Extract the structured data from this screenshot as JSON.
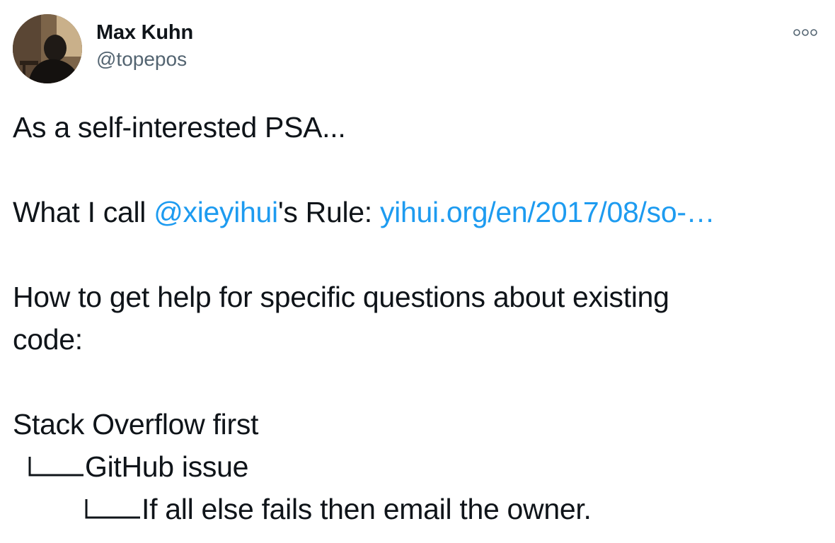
{
  "author": {
    "display_name": "Max Kuhn",
    "handle": "@topepos"
  },
  "icons": {
    "more": "more-horizontal-icon",
    "avatar": "avatar-photo"
  },
  "colors": {
    "link": "#1d9bf0",
    "text": "#0f1419",
    "secondary": "#536471"
  },
  "tweet": {
    "line1": "As a self-interested PSA...",
    "line2_prefix": "What I call ",
    "line2_mention": "@xieyihui",
    "line2_middle": "'s Rule: ",
    "line2_link": "yihui.org/en/2017/08/so-…",
    "line3a": "How to get help for specific questions about existing",
    "line3b": "code:",
    "tree": {
      "root": "Stack Overflow first",
      "child": "GitHub issue",
      "grandchild": "If all else fails then email the owner."
    }
  }
}
